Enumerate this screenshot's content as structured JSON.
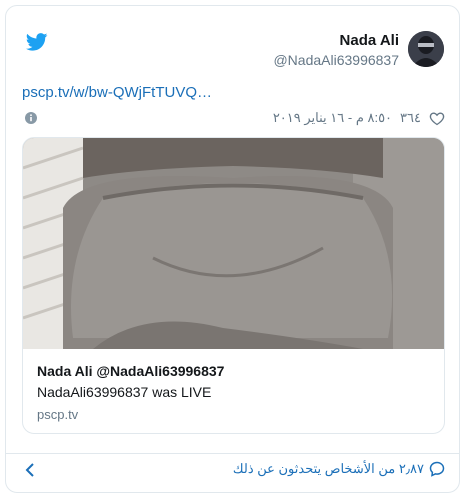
{
  "tweet": {
    "display_name": "Nada Ali",
    "handle": "@NadaAli63996837",
    "link_text": "pscp.tv/w/bw-QWjFtTUVQ…",
    "timestamp": "٨:٥٠ م - ١٦ يناير ٢٠١٩",
    "likes": "٣٦٤"
  },
  "card": {
    "title": "Nada Ali @NadaAli63996837",
    "description": "NadaAli63996837 was LIVE",
    "domain": "pscp.tv"
  },
  "footer": {
    "talking_text": "٢٫٨٧ من الأشخاص يتحدثون عن ذلك"
  },
  "icons": {
    "brand": "twitter-bird-icon",
    "like": "heart-icon",
    "info": "info-icon",
    "reply": "speech-bubble-icon",
    "nav": "chevron-left-icon"
  },
  "colors": {
    "brand_blue": "#1da1f2",
    "link_blue": "#1b6fb8",
    "muted_gray": "#657786",
    "border": "#e1e8ed"
  }
}
